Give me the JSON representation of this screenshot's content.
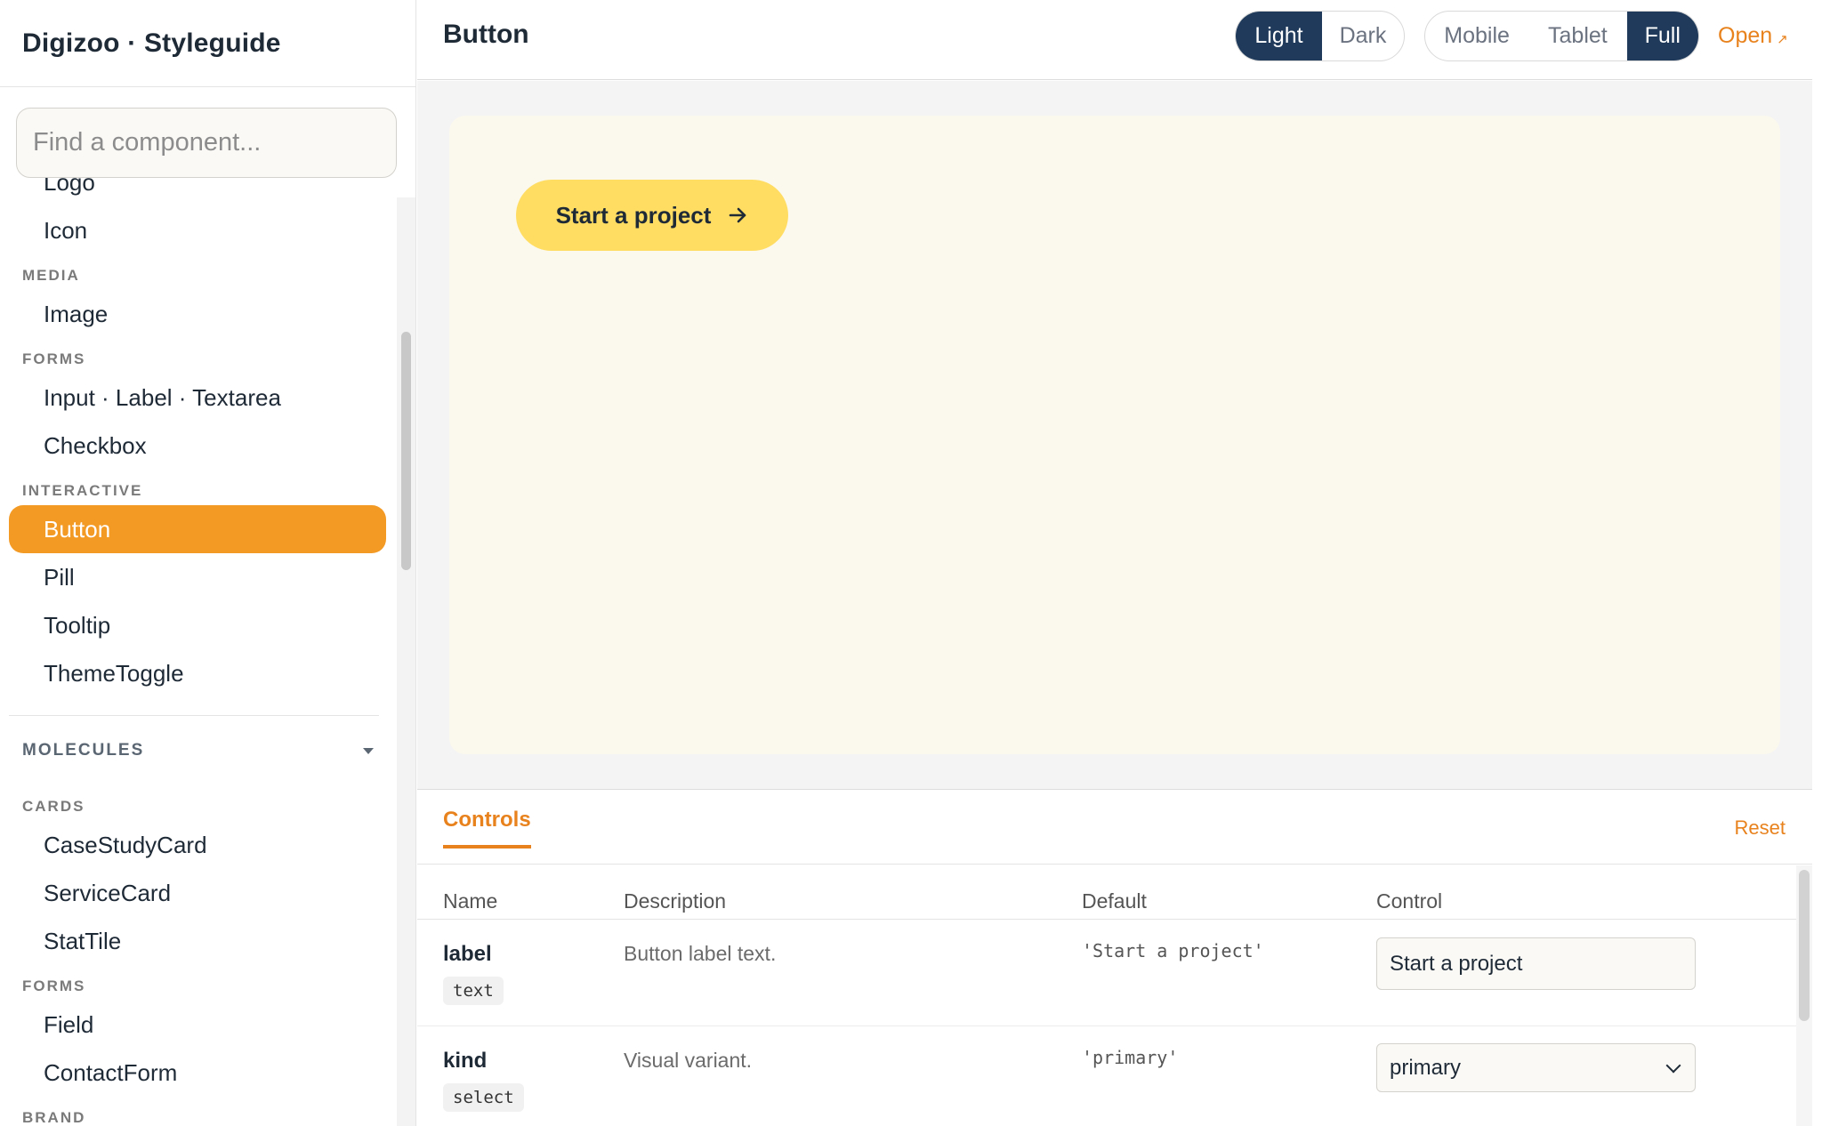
{
  "brand": "Digizoo · Styleguide",
  "search": {
    "placeholder": "Find a component..."
  },
  "nav": {
    "partial_item": "Logo",
    "items_top": [
      "Icon"
    ],
    "sections": [
      {
        "title": "MEDIA",
        "items": [
          "Image"
        ]
      },
      {
        "title": "FORMS",
        "items": [
          "Input · Label · Textarea",
          "Checkbox"
        ]
      },
      {
        "title": "INTERACTIVE",
        "items": [
          "Button",
          "Pill",
          "Tooltip",
          "ThemeToggle"
        ]
      }
    ],
    "active_item": "Button",
    "group_molecules": "MOLECULES",
    "molecule_sections": [
      {
        "title": "CARDS",
        "items": [
          "CaseStudyCard",
          "ServiceCard",
          "StatTile"
        ]
      },
      {
        "title": "FORMS",
        "items": [
          "Field",
          "ContactForm"
        ]
      }
    ],
    "partial_section": "BRAND"
  },
  "topbar": {
    "title": "Button",
    "theme_options": [
      "Light",
      "Dark"
    ],
    "theme_selected": "Light",
    "view_options": [
      "Mobile",
      "Tablet",
      "Full"
    ],
    "view_selected": "Full",
    "open_label": "Open",
    "open_icon": "↗"
  },
  "preview": {
    "button_label": "Start a project",
    "button_icon": "arrow-right-icon"
  },
  "controls": {
    "tab_label": "Controls",
    "reset_label": "Reset",
    "columns": [
      "Name",
      "Description",
      "Default",
      "Control"
    ],
    "rows": [
      {
        "name": "label",
        "type": "text",
        "description": "Button label text.",
        "default": "'Start a project'",
        "control_value": "Start a project"
      },
      {
        "name": "kind",
        "type": "select",
        "description": "Visual variant.",
        "default": "'primary'",
        "control_value": "primary"
      }
    ]
  },
  "colors": {
    "accent": "#f39a25",
    "link": "#e8821d",
    "navy": "#1f3a5a",
    "button_yellow": "#ffdd63",
    "canvas": "#fbf8ee"
  }
}
